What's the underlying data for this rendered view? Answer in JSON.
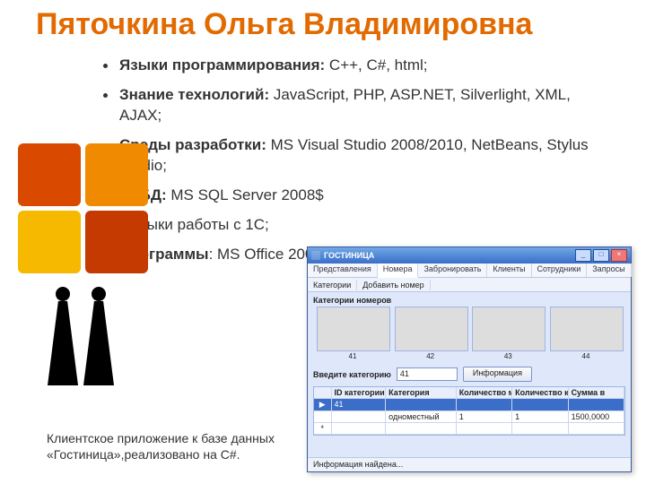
{
  "title": "Пяточкина Ольга Владимировна",
  "bullets": [
    {
      "label": "Языки программирования:",
      "text": " C++, C#, html;"
    },
    {
      "label": "Знание технологий:",
      "text": " JavaScript, PHP, ASP.NET, Silverlight, XML, AJAX;"
    },
    {
      "label": "Среды разработки:",
      "text": " MS Visual Studio 2008/2010, NetBeans, Stylus Studio;"
    },
    {
      "label": "СУБД:",
      "text": " MS SQL Server 2008$"
    },
    {
      "label": "",
      "text": "Навыки работы с 1С;"
    },
    {
      "label": "Программы",
      "text": ": MS Office 2003/2007, Internet."
    }
  ],
  "caption": "Клиентское приложение к базе данных «Гостиница»,реализовано на C#.",
  "app": {
    "title": "ГОСТИНИЦА",
    "win_min": "_",
    "win_max": "□",
    "win_close": "×",
    "tabs": [
      "Представления",
      "Номера",
      "Забронировать",
      "Клиенты",
      "Сотрудники",
      "Запросы"
    ],
    "active_tab": 1,
    "toolbar": [
      "Категории",
      "Добавить номер"
    ],
    "section_label": "Категории номеров",
    "thumbs": [
      {
        "cap": "41"
      },
      {
        "cap": "42"
      },
      {
        "cap": "43"
      },
      {
        "cap": "44"
      }
    ],
    "input_label": "Введите категорию",
    "input_value": "41",
    "info_btn": "Информация",
    "grid_headers": [
      "",
      "ID категории",
      "Категория",
      "Количество мест",
      "Количество комнат",
      "Сумма в"
    ],
    "grid_row_sel": [
      "▶",
      "41",
      "",
      "",
      "",
      ""
    ],
    "grid_row": [
      "",
      "",
      "одноместный",
      "1",
      "1",
      "1500,0000"
    ],
    "grid_row_new": [
      "*",
      "",
      "",
      "",
      "",
      ""
    ],
    "status": "Информация найдена..."
  }
}
